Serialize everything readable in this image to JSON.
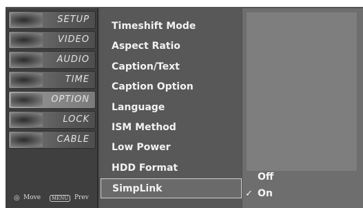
{
  "sidebar": {
    "items": [
      {
        "label": "SETUP"
      },
      {
        "label": "VIDEO"
      },
      {
        "label": "AUDIO"
      },
      {
        "label": "TIME"
      },
      {
        "label": "OPTION"
      },
      {
        "label": "LOCK"
      },
      {
        "label": "CABLE"
      }
    ],
    "footer": {
      "move": "Move",
      "prev": "Prev"
    }
  },
  "menu": {
    "items": [
      {
        "label": "Timeshift Mode"
      },
      {
        "label": "Aspect Ratio"
      },
      {
        "label": "Caption/Text"
      },
      {
        "label": "Caption Option"
      },
      {
        "label": "Language"
      },
      {
        "label": "ISM Method"
      },
      {
        "label": "Low Power"
      },
      {
        "label": "HDD Format"
      },
      {
        "label": "SimpLink"
      }
    ],
    "selected": "SimpLink"
  },
  "submenu": {
    "options": [
      {
        "label": "Off"
      },
      {
        "label": "On"
      }
    ],
    "checked": "On",
    "check_glyph": "✓"
  }
}
